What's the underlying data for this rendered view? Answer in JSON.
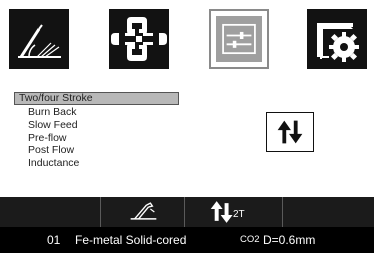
{
  "top_icons": [
    {
      "name": "torch-angle-icon",
      "selected": false
    },
    {
      "name": "chain-link-icon",
      "selected": false
    },
    {
      "name": "adjust-settings-icon",
      "selected": true
    },
    {
      "name": "system-settings-icon",
      "selected": false
    }
  ],
  "menu": {
    "items": [
      {
        "label": "Two/four Stroke",
        "active": true
      },
      {
        "label": "Burn Back",
        "active": false
      },
      {
        "label": "Slow Feed",
        "active": false
      },
      {
        "label": "Pre-flow",
        "active": false
      },
      {
        "label": "Post Flow",
        "active": false
      },
      {
        "label": "Inductance",
        "active": false
      }
    ]
  },
  "toggle": {
    "icon": "stroke-toggle-arrows-icon"
  },
  "status_bar": {
    "torch_icon": "torch-trigger-icon",
    "mode_icon": "stroke-mode-arrows-icon",
    "mode_label": "2T"
  },
  "program": {
    "number": "01",
    "wire": "Fe-metal Solid-cored",
    "gas": "CO2",
    "diameter": "D=0.6mm"
  },
  "colors": {
    "dark_tile": "#121212",
    "selected_tile": "#9f9f9f",
    "status_bar": "#1b1b1b",
    "info_bar": "#000000",
    "menu_highlight": "#b8b8b8"
  }
}
